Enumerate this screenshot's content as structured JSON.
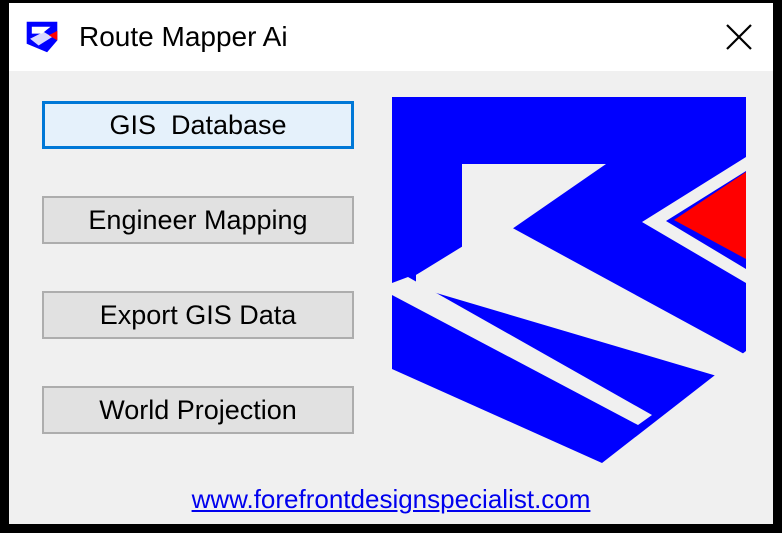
{
  "window": {
    "title": "Route Mapper Ai",
    "icon": "route-mapper-logo-icon",
    "close_icon": "close-icon"
  },
  "buttons": [
    {
      "label": "GIS  Database",
      "focused": true
    },
    {
      "label": "Engineer Mapping",
      "focused": false
    },
    {
      "label": "Export GIS Data",
      "focused": false
    },
    {
      "label": "World Projection",
      "focused": false
    }
  ],
  "logo": {
    "name": "route-mapper-logo",
    "colors": {
      "primary": "#0000ff",
      "accent": "#ff0000",
      "background": "#f0f0f0"
    }
  },
  "footer": {
    "link_text": "www.forefrontdesignspecialist.com",
    "link_color": "#0000ee"
  }
}
